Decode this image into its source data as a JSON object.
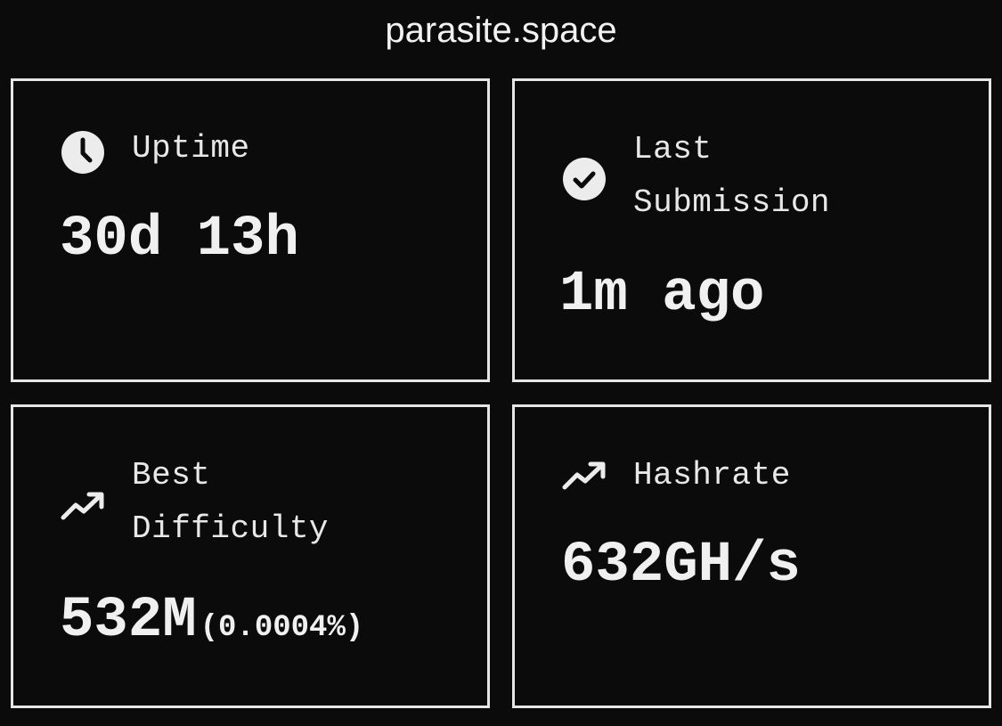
{
  "header": {
    "title": "parasite.space"
  },
  "cards": {
    "uptime": {
      "icon": "clock-icon",
      "label": "Uptime",
      "value": "30d 13h"
    },
    "last_submission": {
      "icon": "check-circle-icon",
      "label": "Last\nSubmission",
      "value": "1m ago"
    },
    "best_difficulty": {
      "icon": "trending-up-icon",
      "label": "Best\nDifficulty",
      "value": "532M",
      "sub_value": "(0.0004%)"
    },
    "hashrate": {
      "icon": "trending-up-icon",
      "label": "Hashrate",
      "value": "632GH/s"
    }
  },
  "colors": {
    "background": "#0b0b0b",
    "foreground": "#ececec",
    "border": "#e6e6e6"
  }
}
